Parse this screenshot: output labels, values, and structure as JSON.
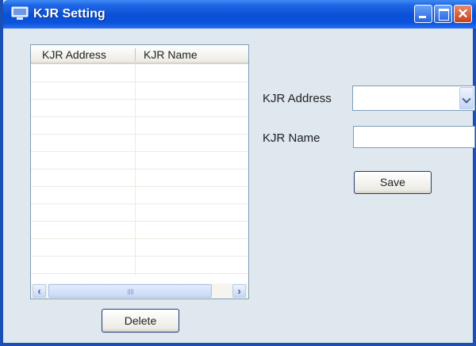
{
  "window": {
    "title": "KJR Setting",
    "icon": "monitor-icon"
  },
  "list": {
    "columns": [
      "KJR Address",
      "KJR Name"
    ],
    "rows": []
  },
  "form": {
    "address_label": "KJR Address",
    "address_value": "",
    "name_label": "KJR Name",
    "name_value": "",
    "save_label": "Save"
  },
  "actions": {
    "delete_label": "Delete"
  },
  "colors": {
    "titlebar": "#0a4fd6",
    "window_bg": "#dfe7ef",
    "close_button": "#c8401c"
  }
}
